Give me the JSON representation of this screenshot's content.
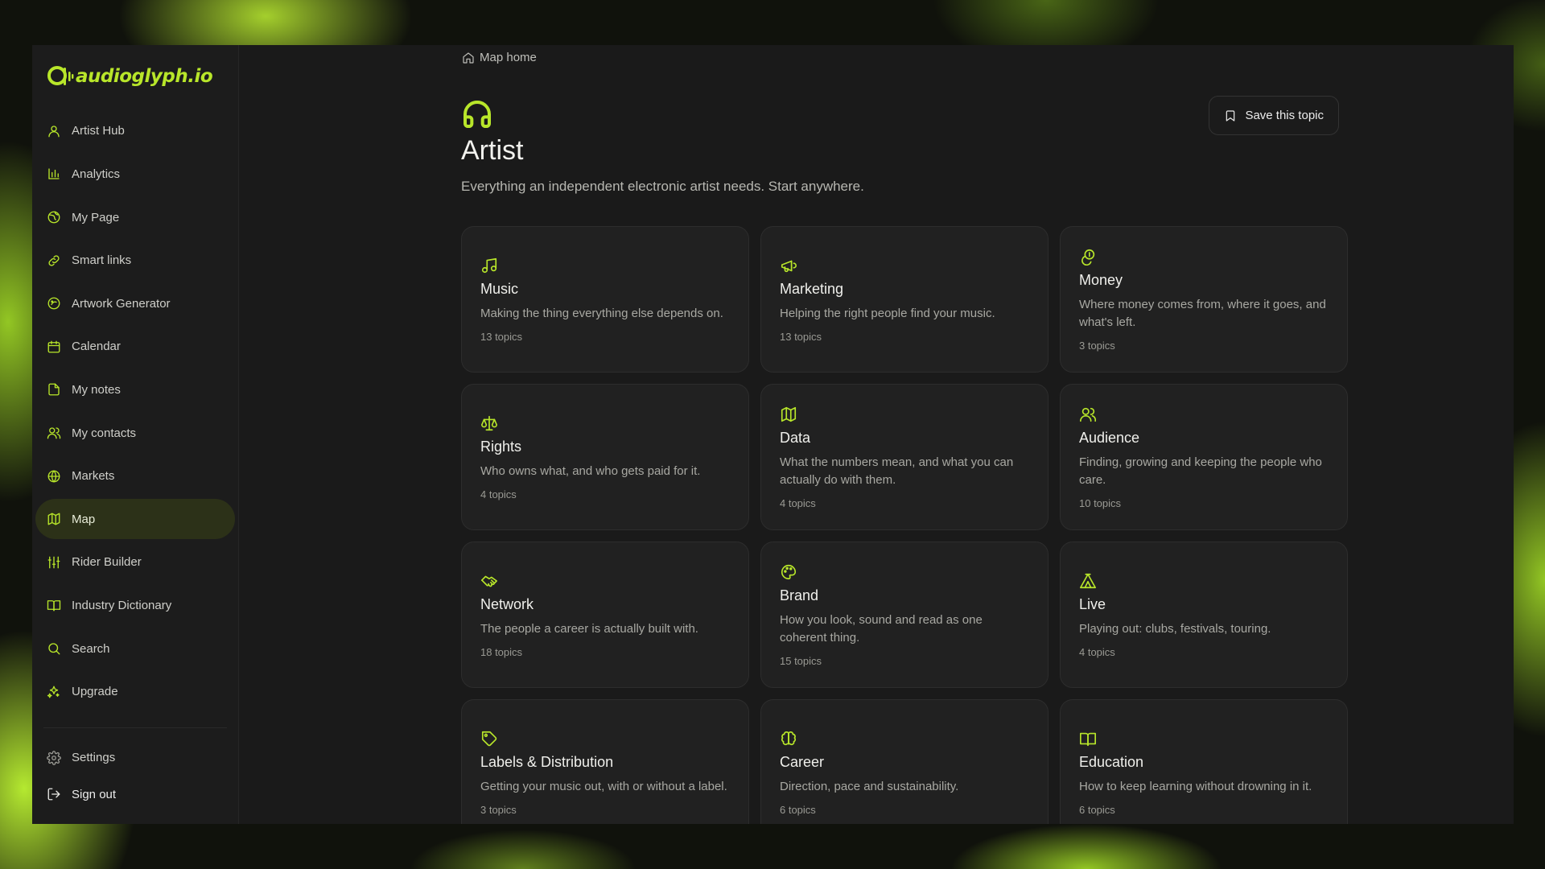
{
  "brand": {
    "name": "audioglyph.io",
    "accent": "#b8e62a"
  },
  "sidebar": {
    "items": [
      {
        "label": "Artist Hub",
        "icon": "user-icon"
      },
      {
        "label": "Analytics",
        "icon": "bar-chart-icon"
      },
      {
        "label": "My Page",
        "icon": "globe-icon"
      },
      {
        "label": "Smart links",
        "icon": "link-icon"
      },
      {
        "label": "Artwork Generator",
        "icon": "sparkle-circle-icon"
      },
      {
        "label": "Calendar",
        "icon": "calendar-icon"
      },
      {
        "label": "My notes",
        "icon": "file-icon"
      },
      {
        "label": "My contacts",
        "icon": "users-icon"
      },
      {
        "label": "Markets",
        "icon": "globe-grid-icon"
      },
      {
        "label": "Map",
        "icon": "map-icon",
        "active": true
      },
      {
        "label": "Rider Builder",
        "icon": "sliders-icon"
      },
      {
        "label": "Industry Dictionary",
        "icon": "book-open-icon"
      },
      {
        "label": "Search",
        "icon": "search-icon"
      },
      {
        "label": "Upgrade",
        "icon": "sparkles-icon"
      }
    ],
    "settings_label": "Settings",
    "signout_label": "Sign out"
  },
  "breadcrumb": {
    "label": "Map home"
  },
  "page": {
    "icon": "headphones-icon",
    "title": "Artist",
    "subtitle": "Everything an independent electronic artist needs. Start anywhere.",
    "save_label": "Save this topic"
  },
  "cards": [
    {
      "title": "Music",
      "desc": "Making the thing everything else depends on.",
      "count": "13 topics",
      "icon": "music-note-icon"
    },
    {
      "title": "Marketing",
      "desc": "Helping the right people find your music.",
      "count": "13 topics",
      "icon": "megaphone-icon"
    },
    {
      "title": "Money",
      "desc": "Where money comes from, where it goes, and what's left.",
      "count": "3 topics",
      "icon": "coins-icon"
    },
    {
      "title": "Rights",
      "desc": "Who owns what, and who gets paid for it.",
      "count": "4 topics",
      "icon": "scale-icon"
    },
    {
      "title": "Data",
      "desc": "What the numbers mean, and what you can actually do with them.",
      "count": "4 topics",
      "icon": "map-icon"
    },
    {
      "title": "Audience",
      "desc": "Finding, growing and keeping the people who care.",
      "count": "10 topics",
      "icon": "users-icon"
    },
    {
      "title": "Network",
      "desc": "The people a career is actually built with.",
      "count": "18 topics",
      "icon": "handshake-icon"
    },
    {
      "title": "Brand",
      "desc": "How you look, sound and read as one coherent thing.",
      "count": "15 topics",
      "icon": "palette-icon"
    },
    {
      "title": "Live",
      "desc": "Playing out: clubs, festivals, touring.",
      "count": "4 topics",
      "icon": "tent-icon"
    },
    {
      "title": "Labels & Distribution",
      "desc": "Getting your music out, with or without a label.",
      "count": "3 topics",
      "icon": "tag-icon"
    },
    {
      "title": "Career",
      "desc": "Direction, pace and sustainability.",
      "count": "6 topics",
      "icon": "brain-icon"
    },
    {
      "title": "Education",
      "desc": "How to keep learning without drowning in it.",
      "count": "6 topics",
      "icon": "book-open-icon"
    }
  ]
}
